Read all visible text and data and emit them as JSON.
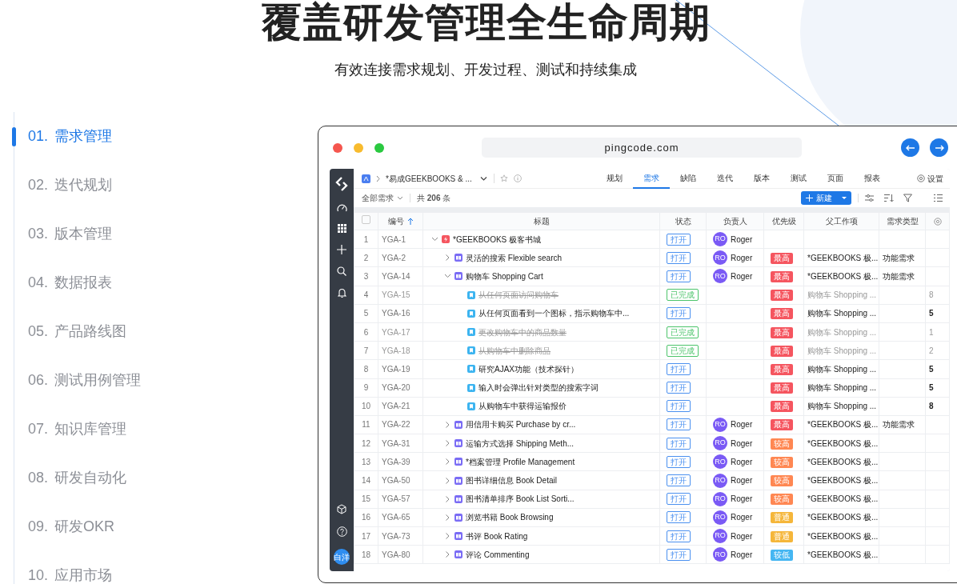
{
  "heading": {
    "title": "覆盖研发管理全生命周期",
    "subtitle": "有效连接需求规划、开发过程、测试和持续集成"
  },
  "feature_nav": [
    {
      "number": "01.",
      "label": "需求管理",
      "selected": true
    },
    {
      "number": "02.",
      "label": "迭代规划",
      "selected": false
    },
    {
      "number": "03.",
      "label": "版本管理",
      "selected": false
    },
    {
      "number": "04.",
      "label": "数据报表",
      "selected": false
    },
    {
      "number": "05.",
      "label": "产品路线图",
      "selected": false
    },
    {
      "number": "06.",
      "label": "测试用例管理",
      "selected": false
    },
    {
      "number": "07.",
      "label": "知识库管理",
      "selected": false
    },
    {
      "number": "08.",
      "label": "研发自动化",
      "selected": false
    },
    {
      "number": "09.",
      "label": "研发OKR",
      "selected": false
    },
    {
      "number": "10.",
      "label": "应用市场",
      "selected": false
    }
  ],
  "browser": {
    "url": "pingcode.com"
  },
  "app": {
    "project": "*易成GEEKBOOKS & ...",
    "tabs": [
      {
        "label": "规划",
        "selected": false
      },
      {
        "label": "需求",
        "selected": true
      },
      {
        "label": "缺陷",
        "selected": false
      },
      {
        "label": "迭代",
        "selected": false
      },
      {
        "label": "版本",
        "selected": false
      },
      {
        "label": "测试",
        "selected": false
      },
      {
        "label": "页面",
        "selected": false
      },
      {
        "label": "报表",
        "selected": false
      }
    ],
    "settings": "设置",
    "select_all": {
      "checked": false
    },
    "user_avatar": "白洋",
    "filter": "全部需求",
    "count_prefix": "共",
    "count": "206",
    "count_suffix": "条",
    "new_button": "新建",
    "columns": [
      "编号",
      "标题",
      "状态",
      "负责人",
      "优先级",
      "父工作项",
      "需求类型"
    ],
    "rows": [
      {
        "index": "1",
        "id": "YGA-1",
        "kind": "epic",
        "title": "*GEEKBOOKS 极客书城",
        "expanded": true,
        "done": false,
        "status": {
          "label": "打开",
          "color": "#4a90f0"
        },
        "assignee": {
          "initials": "RO",
          "name": "Roger"
        },
        "children": [
          {
            "index": "2",
            "id": "YGA-2",
            "kind": "feature",
            "title": "灵活的搜索 Flexible search",
            "expanded": false,
            "done": false,
            "status": {
              "label": "打开",
              "color": "#4a90f0"
            },
            "assignee": {
              "initials": "RO",
              "name": "Roger"
            },
            "priority": {
              "label": "最高",
              "color": "#f5555f"
            },
            "parent": "*GEEKBOOKS 极...",
            "type": "功能需求"
          },
          {
            "index": "3",
            "id": "YGA-14",
            "kind": "feature",
            "title": "购物车 Shopping Cart",
            "expanded": true,
            "done": false,
            "status": {
              "label": "打开",
              "color": "#4a90f0"
            },
            "assignee": {
              "initials": "RO",
              "name": "Roger"
            },
            "priority": {
              "label": "最高",
              "color": "#f5555f"
            },
            "parent": "*GEEKBOOKS 极...",
            "type": "功能需求",
            "children": [
              {
                "index": "4",
                "id": "YGA-15",
                "kind": "story",
                "title": "从任何页面访问购物车",
                "done": true,
                "status": {
                  "label": "已完成",
                  "color": "#4cc46b"
                },
                "priority": {
                  "label": "最高",
                  "color": "#f5555f"
                },
                "parent": "购物车 Shopping ...",
                "column_8": "8"
              },
              {
                "index": "5",
                "id": "YGA-16",
                "kind": "story",
                "title": "从任何页面看到一个图标，指示购物车中...",
                "done": false,
                "status": {
                  "label": "打开",
                  "color": "#4a90f0"
                },
                "priority": {
                  "label": "最高",
                  "color": "#f5555f"
                },
                "parent": "购物车 Shopping ...",
                "column_8": "5"
              },
              {
                "index": "6",
                "id": "YGA-17",
                "kind": "story",
                "title": "更改购物车中的商品数量",
                "done": true,
                "status": {
                  "label": "已完成",
                  "color": "#4cc46b"
                },
                "priority": {
                  "label": "最高",
                  "color": "#f5555f"
                },
                "parent": "购物车 Shopping ...",
                "column_8": "1"
              },
              {
                "index": "7",
                "id": "YGA-18",
                "kind": "story",
                "title": "从购物车中删除商品",
                "done": true,
                "status": {
                  "label": "已完成",
                  "color": "#4cc46b"
                },
                "priority": {
                  "label": "最高",
                  "color": "#f5555f"
                },
                "parent": "购物车 Shopping ...",
                "column_8": "2"
              },
              {
                "index": "8",
                "id": "YGA-19",
                "kind": "story",
                "title": "研究AJAX功能（技术探针）",
                "done": false,
                "status": {
                  "label": "打开",
                  "color": "#4a90f0"
                },
                "priority": {
                  "label": "最高",
                  "color": "#f5555f"
                },
                "parent": "购物车 Shopping ...",
                "column_8": "5"
              },
              {
                "index": "9",
                "id": "YGA-20",
                "kind": "story",
                "title": "输入时会弹出针对类型的搜索字词",
                "done": false,
                "status": {
                  "label": "打开",
                  "color": "#4a90f0"
                },
                "priority": {
                  "label": "最高",
                  "color": "#f5555f"
                },
                "parent": "购物车 Shopping ...",
                "column_8": "5"
              },
              {
                "index": "10",
                "id": "YGA-21",
                "kind": "story",
                "title": "从购物车中获得运输报价",
                "done": false,
                "status": {
                  "label": "打开",
                  "color": "#4a90f0"
                },
                "priority": {
                  "label": "最高",
                  "color": "#f5555f"
                },
                "parent": "购物车 Shopping ...",
                "column_8": "8"
              }
            ]
          },
          {
            "index": "11",
            "id": "YGA-22",
            "kind": "feature",
            "title": "用信用卡购买 Purchase by cr...",
            "expanded": false,
            "done": false,
            "status": {
              "label": "打开",
              "color": "#4a90f0"
            },
            "assignee": {
              "initials": "RO",
              "name": "Roger"
            },
            "priority": {
              "label": "最高",
              "color": "#f5555f"
            },
            "parent": "*GEEKBOOKS 极...",
            "type": "功能需求"
          },
          {
            "index": "12",
            "id": "YGA-31",
            "kind": "feature",
            "title": "运输方式选择 Shipping Meth...",
            "expanded": false,
            "done": false,
            "status": {
              "label": "打开",
              "color": "#4a90f0"
            },
            "assignee": {
              "initials": "RO",
              "name": "Roger"
            },
            "priority": {
              "label": "较高",
              "color": "#ff8752"
            },
            "parent": "*GEEKBOOKS 极..."
          },
          {
            "index": "13",
            "id": "YGA-39",
            "kind": "feature",
            "title": "*档案管理 Profile Management",
            "expanded": false,
            "done": false,
            "status": {
              "label": "打开",
              "color": "#4a90f0"
            },
            "assignee": {
              "initials": "RO",
              "name": "Roger"
            },
            "priority": {
              "label": "较高",
              "color": "#ff8752"
            },
            "parent": "*GEEKBOOKS 极..."
          },
          {
            "index": "14",
            "id": "YGA-50",
            "kind": "feature",
            "title": "图书详细信息 Book Detail",
            "expanded": false,
            "done": false,
            "status": {
              "label": "打开",
              "color": "#4a90f0"
            },
            "assignee": {
              "initials": "RO",
              "name": "Roger"
            },
            "priority": {
              "label": "较高",
              "color": "#ff8752"
            },
            "parent": "*GEEKBOOKS 极..."
          },
          {
            "index": "15",
            "id": "YGA-57",
            "kind": "feature",
            "title": "图书清单排序 Book List Sorti...",
            "expanded": false,
            "done": false,
            "status": {
              "label": "打开",
              "color": "#4a90f0"
            },
            "assignee": {
              "initials": "RO",
              "name": "Roger"
            },
            "priority": {
              "label": "较高",
              "color": "#ff8752"
            },
            "parent": "*GEEKBOOKS 极..."
          },
          {
            "index": "16",
            "id": "YGA-65",
            "kind": "feature",
            "title": "浏览书籍 Book Browsing",
            "expanded": false,
            "done": false,
            "status": {
              "label": "打开",
              "color": "#4a90f0"
            },
            "assignee": {
              "initials": "RO",
              "name": "Roger"
            },
            "priority": {
              "label": "普通",
              "color": "#f5b63a"
            },
            "parent": "*GEEKBOOKS 极..."
          },
          {
            "index": "17",
            "id": "YGA-73",
            "kind": "feature",
            "title": "书评 Book Rating",
            "expanded": false,
            "done": false,
            "status": {
              "label": "打开",
              "color": "#4a90f0"
            },
            "assignee": {
              "initials": "RO",
              "name": "Roger"
            },
            "priority": {
              "label": "普通",
              "color": "#f5b63a"
            },
            "parent": "*GEEKBOOKS 极..."
          },
          {
            "index": "18",
            "id": "YGA-80",
            "kind": "feature",
            "title": "评论 Commenting",
            "expanded": false,
            "done": false,
            "status": {
              "label": "打开",
              "color": "#4a90f0"
            },
            "assignee": {
              "initials": "RO",
              "name": "Roger"
            },
            "priority": {
              "label": "较低",
              "color": "#45b6f2"
            },
            "parent": "*GEEKBOOKS 极..."
          }
        ]
      }
    ]
  }
}
